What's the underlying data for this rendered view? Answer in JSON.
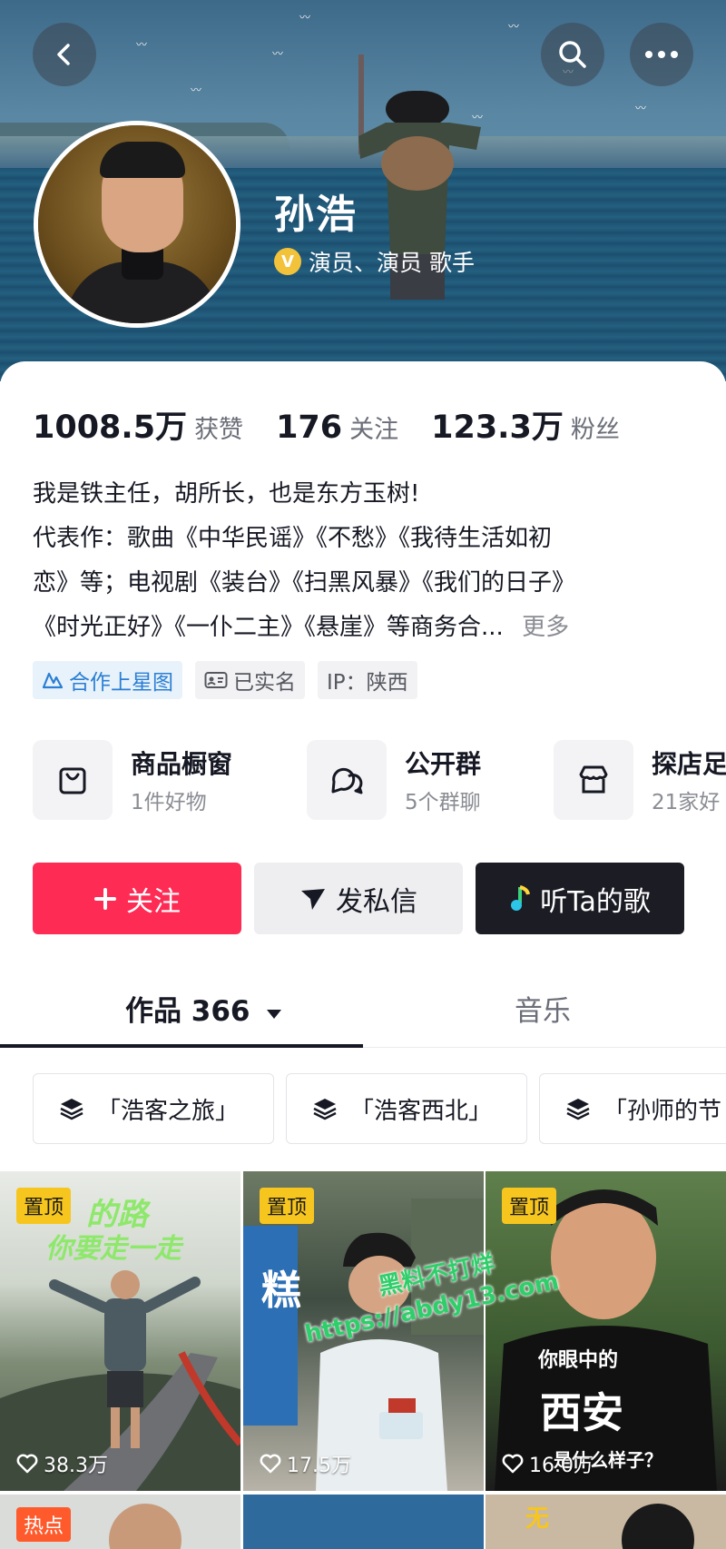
{
  "profile": {
    "name": "孙浩",
    "verify_badge": "V",
    "verify_text": "演员、演员 歌手"
  },
  "stats": [
    {
      "value": "1008.5万",
      "label": "获赞"
    },
    {
      "value": "176",
      "label": "关注"
    },
    {
      "value": "123.3万",
      "label": "粉丝"
    }
  ],
  "bio": {
    "line1": "我是铁主任，胡所长，也是东方玉树!",
    "line2": "代表作：歌曲《中华民谣》《不愁》《我待生活如初",
    "line3": "恋》等；电视剧《装台》《扫黑风暴》《我们的日子》",
    "line4": "《时光正好》《一仆二主》《悬崖》等商务合...",
    "more": "更多"
  },
  "tags": [
    {
      "label": "合作上星图",
      "icon": "star-map-icon"
    },
    {
      "label": "已实名",
      "icon": "id-card-icon"
    },
    {
      "label": "IP：陕西"
    }
  ],
  "services": [
    {
      "title": "商品橱窗",
      "sub": "1件好物",
      "icon": "shopping-bag-icon"
    },
    {
      "title": "公开群",
      "sub": "5个群聊",
      "icon": "chat-bubbles-icon"
    },
    {
      "title": "探店足",
      "sub": "21家好",
      "icon": "storefront-icon"
    }
  ],
  "actions": {
    "follow": "关注",
    "message": "发私信",
    "song": "听Ta的歌"
  },
  "tabs": {
    "works": "作品 366",
    "music": "音乐"
  },
  "collections": [
    "「浩客之旅」",
    "「浩客西北」",
    "「孙师的节"
  ],
  "videos": [
    {
      "badge": "置顶",
      "likes": "38.3万",
      "overlay": "的路",
      "overlay2": "你要走一走"
    },
    {
      "badge": "置顶",
      "likes": "17.5万",
      "overlay": "糕"
    },
    {
      "badge": "置顶",
      "likes": "16.0万",
      "overlay": "你眼中的",
      "overlay2": "西安",
      "overlay3": "是什么样子？"
    }
  ],
  "row2": [
    {
      "badge": "热点"
    },
    {},
    {
      "badge": "无"
    }
  ],
  "watermark": {
    "line1": "黑料不打烊",
    "line2": "https://abdy13.com"
  },
  "colors": {
    "follow": "#fe2c55",
    "pin": "#f7c61e",
    "verify": "#f3c23b",
    "tag_blue": "#2a7fd3"
  }
}
